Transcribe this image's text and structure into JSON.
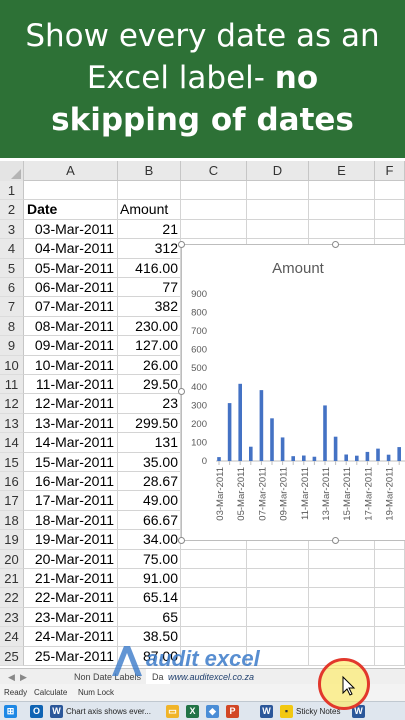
{
  "banner": {
    "line1": "Show every date as an",
    "line2_plain": "Excel label- ",
    "line2_bold": "no",
    "line3": "skipping of dates"
  },
  "columns": [
    "A",
    "B",
    "C",
    "D",
    "E",
    "F"
  ],
  "headers": {
    "date": "Date",
    "amount": "Amount"
  },
  "rows": [
    {
      "n": "1",
      "date": "",
      "amount": ""
    },
    {
      "n": "2",
      "date": "",
      "amount": ""
    },
    {
      "n": "3",
      "date": "03-Mar-2011",
      "amount": "21"
    },
    {
      "n": "4",
      "date": "04-Mar-2011",
      "amount": "312"
    },
    {
      "n": "5",
      "date": "05-Mar-2011",
      "amount": "416.00"
    },
    {
      "n": "6",
      "date": "06-Mar-2011",
      "amount": "77"
    },
    {
      "n": "7",
      "date": "07-Mar-2011",
      "amount": "382"
    },
    {
      "n": "8",
      "date": "08-Mar-2011",
      "amount": "230.00"
    },
    {
      "n": "9",
      "date": "09-Mar-2011",
      "amount": "127.00"
    },
    {
      "n": "10",
      "date": "10-Mar-2011",
      "amount": "26.00"
    },
    {
      "n": "11",
      "date": "11-Mar-2011",
      "amount": "29.50"
    },
    {
      "n": "12",
      "date": "12-Mar-2011",
      "amount": "23"
    },
    {
      "n": "13",
      "date": "13-Mar-2011",
      "amount": "299.50"
    },
    {
      "n": "14",
      "date": "14-Mar-2011",
      "amount": "131"
    },
    {
      "n": "15",
      "date": "15-Mar-2011",
      "amount": "35.00"
    },
    {
      "n": "16",
      "date": "16-Mar-2011",
      "amount": "28.67"
    },
    {
      "n": "17",
      "date": "17-Mar-2011",
      "amount": "49.00"
    },
    {
      "n": "18",
      "date": "18-Mar-2011",
      "amount": "66.67"
    },
    {
      "n": "19",
      "date": "19-Mar-2011",
      "amount": "34.00"
    },
    {
      "n": "20",
      "date": "20-Mar-2011",
      "amount": "75.00"
    },
    {
      "n": "21",
      "date": "21-Mar-2011",
      "amount": "91.00"
    },
    {
      "n": "22",
      "date": "22-Mar-2011",
      "amount": "65.14"
    },
    {
      "n": "23",
      "date": "23-Mar-2011",
      "amount": "65"
    },
    {
      "n": "24",
      "date": "24-Mar-2011",
      "amount": "38.50"
    },
    {
      "n": "25",
      "date": "25-Mar-2011",
      "amount": "87.00"
    }
  ],
  "chart_data": {
    "type": "bar",
    "title": "Amount",
    "categories": [
      "03-Mar-2011",
      "04-Mar-2011",
      "05-Mar-2011",
      "06-Mar-2011",
      "07-Mar-2011",
      "08-Mar-2011",
      "09-Mar-2011",
      "10-Mar-2011",
      "11-Mar-2011",
      "12-Mar-2011",
      "13-Mar-2011",
      "14-Mar-2011",
      "15-Mar-2011",
      "16-Mar-2011",
      "17-Mar-2011",
      "18-Mar-2011",
      "19-Mar-2011",
      "20-Mar-2011"
    ],
    "values": [
      21,
      312,
      416,
      77,
      382,
      230,
      127,
      26,
      29.5,
      23,
      299.5,
      131,
      35,
      28.67,
      49,
      66.67,
      34,
      75
    ],
    "visible_tick_labels": [
      "03-Mar-2011",
      "05-Mar-2011",
      "07-Mar-2011",
      "09-Mar-2011",
      "11-Mar-2011",
      "13-Mar-2011",
      "15-Mar-2011",
      "17-Mar-2011",
      "19-Mar-2011"
    ],
    "yticks": [
      "900",
      "800",
      "700",
      "600",
      "500",
      "400",
      "300",
      "200",
      "100",
      "0"
    ],
    "ylim": [
      0,
      900
    ],
    "bar_color": "#4472c4",
    "grid": false
  },
  "sheet_tabs": {
    "tab1": "Non Date Labels",
    "tab2": "Da"
  },
  "status": {
    "ready": "Ready",
    "calculate": "Calculate",
    "numlock": "Num Lock"
  },
  "taskbar": {
    "chart_window": "Chart axis shows ever...",
    "sticky": "Sticky Notes"
  },
  "watermark": {
    "brand": "audit excel",
    "url": "www.auditexcel.co.za"
  },
  "colors": {
    "banner": "#2d7136",
    "accent_blue": "#4472c4"
  }
}
